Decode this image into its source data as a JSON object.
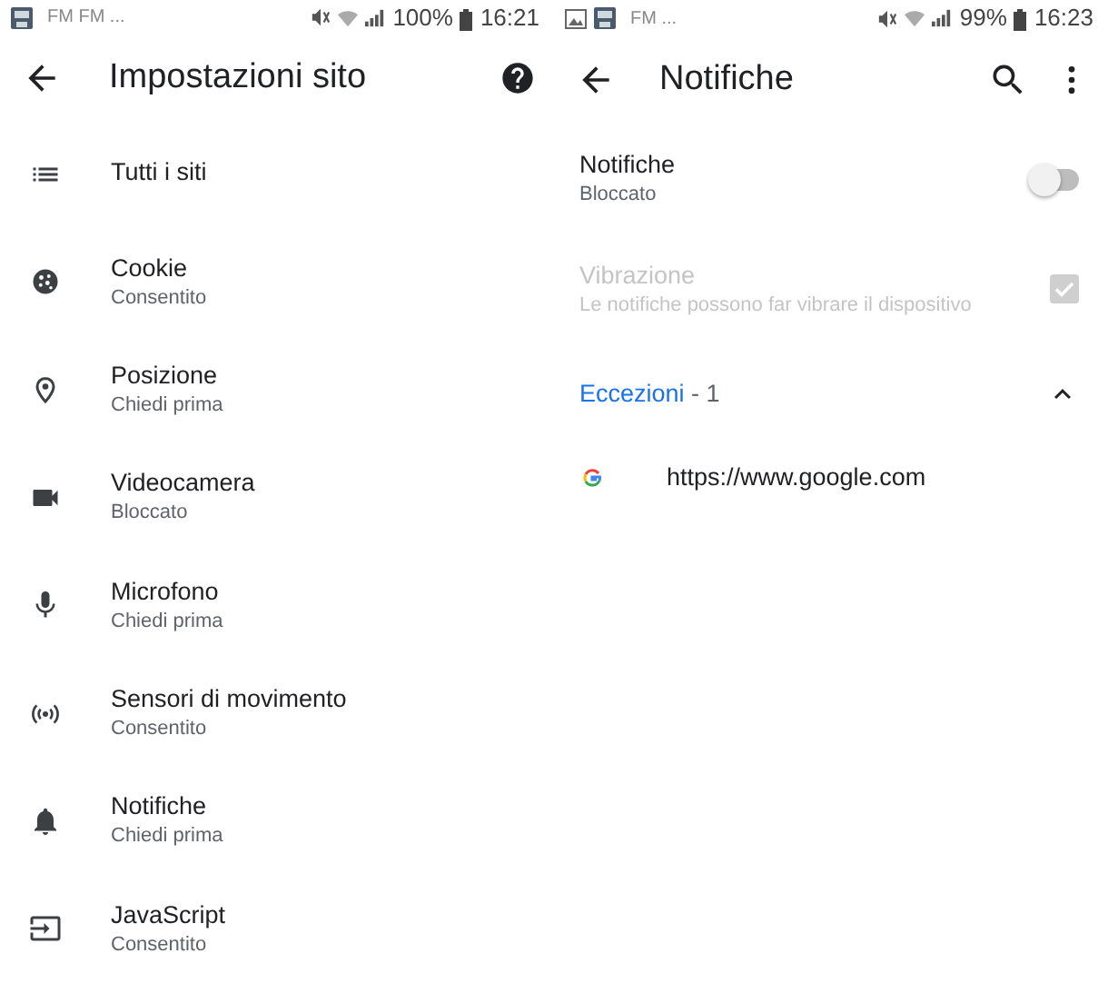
{
  "screens": [
    {
      "status_bar": {
        "notifications": "FM FM ...",
        "battery": "100%",
        "time": "16:21"
      },
      "app_bar": {
        "title": "Impostazioni sito"
      },
      "items": [
        {
          "kind": "list",
          "title": "Tutti i siti"
        },
        {
          "kind": "cookie",
          "title": "Cookie",
          "subtitle": "Consentito"
        },
        {
          "kind": "location",
          "title": "Posizione",
          "subtitle": "Chiedi prima"
        },
        {
          "kind": "camera",
          "title": "Videocamera",
          "subtitle": "Bloccato"
        },
        {
          "kind": "mic",
          "title": "Microfono",
          "subtitle": "Chiedi prima"
        },
        {
          "kind": "sensors",
          "title": "Sensori di movimento",
          "subtitle": "Consentito"
        },
        {
          "kind": "bell",
          "title": "Notifiche",
          "subtitle": "Chiedi prima"
        },
        {
          "kind": "javascript",
          "title": "JavaScript",
          "subtitle": "Consentito"
        }
      ]
    },
    {
      "status_bar": {
        "notifications": "FM ...",
        "battery": "99%",
        "time": "16:23"
      },
      "app_bar": {
        "title": "Notifiche"
      },
      "settings": [
        {
          "kind": "toggle",
          "title": "Notifiche",
          "subtitle": "Bloccato",
          "on": false,
          "disabled": false
        },
        {
          "kind": "checkbox",
          "title": "Vibrazione",
          "subtitle": "Le notifiche possono far vibrare il dispositivo",
          "checked": true,
          "disabled": true
        }
      ],
      "exceptions": {
        "title": "Eccezioni",
        "count": " - 1",
        "expanded": true,
        "sites": [
          {
            "url": "https://www.google.com"
          }
        ]
      }
    }
  ]
}
